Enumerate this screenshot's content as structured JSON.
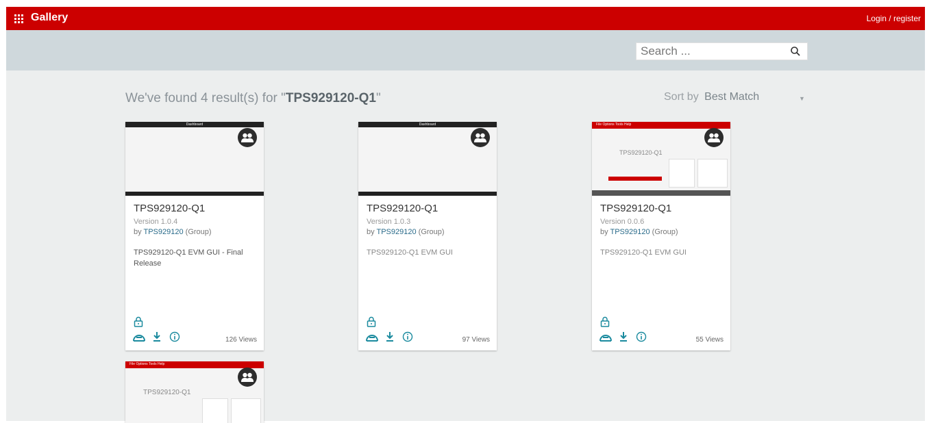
{
  "header": {
    "title": "Gallery",
    "login_label": "Login / register",
    "bg_color": "#cc0000"
  },
  "search": {
    "placeholder": "Search ...",
    "icon": "search-icon"
  },
  "results": {
    "prefix": "We've found 4 result(s) for \"",
    "query": "TPS929120-Q1",
    "suffix": "\""
  },
  "sort": {
    "label": "Sort by",
    "value": "Best Match"
  },
  "cards": [
    {
      "thumb_title": "Dashboard",
      "title": "TPS929120-Q1",
      "version": "Version 1.0.4",
      "by_prefix": "by",
      "owner": "TPS929120",
      "owner_suffix": "(Group)",
      "description": "TPS929120-Q1 EVM GUI - Final Release",
      "views": "126 Views"
    },
    {
      "thumb_title": "Dashboard",
      "title": "TPS929120-Q1",
      "version": "Version 1.0.3",
      "by_prefix": "by",
      "owner": "TPS929120",
      "owner_suffix": "(Group)",
      "description": "TPS929120-Q1 EVM GUI",
      "views": "97 Views"
    },
    {
      "thumb_title": "File   Options   Tools   Help",
      "thumb_heading": "TPS929120-Q1",
      "title": "TPS929120-Q1",
      "version": "Version 0.0.6",
      "by_prefix": "by",
      "owner": "TPS929120",
      "owner_suffix": "(Group)",
      "description": "TPS929120-Q1 EVM GUI",
      "views": "55 Views"
    },
    {
      "thumb_title": "File   Options   Tools   Help",
      "thumb_heading": "TPS929120-Q1"
    }
  ],
  "colors": {
    "accent_teal": "#1a8a9e",
    "link": "#2a6b8a"
  }
}
